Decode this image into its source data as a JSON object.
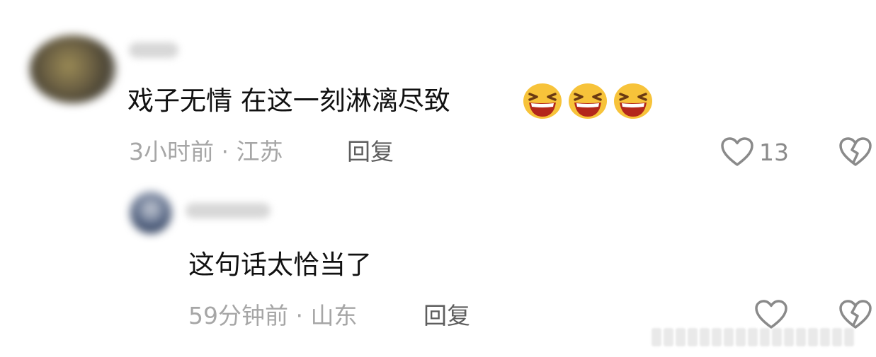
{
  "comments": [
    {
      "text": "戏子无情 在这一刻淋漓尽致",
      "emoji": [
        "squinting-laughing-emoji",
        "squinting-laughing-emoji",
        "squinting-laughing-emoji"
      ],
      "meta": "3小时前 · 江苏",
      "reply_label": "回复",
      "like_count": "13"
    },
    {
      "text": "这句话太恰当了",
      "meta": "59分钟前 · 山东",
      "reply_label": "回复",
      "like_count": ""
    }
  ],
  "colors": {
    "text": "#111111",
    "meta": "#a6a6a6",
    "reply": "#5e5e5e",
    "icon": "#8a8a8a",
    "emoji_face": "#f7c33a"
  },
  "icons": [
    "heart-outline-icon",
    "broken-heart-outline-icon"
  ]
}
